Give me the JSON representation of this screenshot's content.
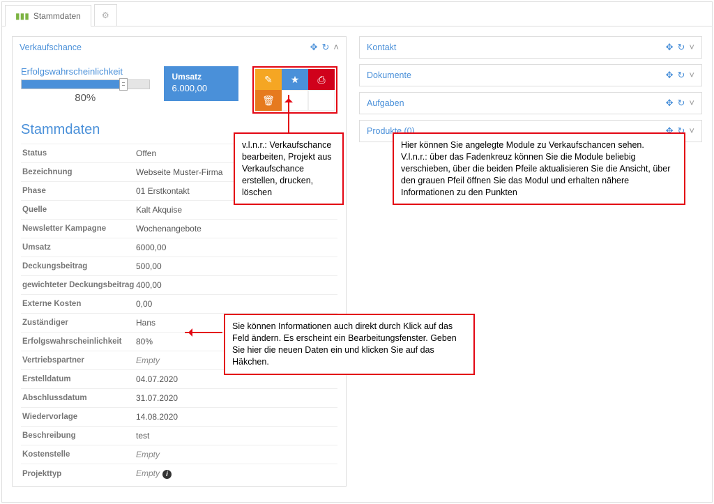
{
  "tabs": {
    "main": "Stammdaten"
  },
  "panel": {
    "verkaufschance_title": "Verkaufschance"
  },
  "metrics": {
    "probability_label": "Erfolgswahrscheinlichkeit",
    "probability_value": "80%",
    "umsatz_label": "Umsatz",
    "umsatz_value": "6.000,00"
  },
  "icons": {
    "edit": "✎",
    "star": "★",
    "print": "⎙",
    "trash": "🗑"
  },
  "section_title": "Stammdaten",
  "fields": {
    "status_label": "Status",
    "status_value": "Offen",
    "bezeichnung_label": "Bezeichnung",
    "bezeichnung_value": "Webseite Muster-Firma",
    "phase_label": "Phase",
    "phase_value": "01 Erstkontakt",
    "quelle_label": "Quelle",
    "quelle_value": "Kalt Akquise",
    "newsletter_label": "Newsletter Kampagne",
    "newsletter_value": "Wochenangebote",
    "umsatz_label": "Umsatz",
    "umsatz_value": "6000,00",
    "deckung_label": "Deckungsbeitrag",
    "deckung_value": "500,00",
    "gewicht_label": "gewichteter Deckungsbeitrag",
    "gewicht_value": "400,00",
    "externe_label": "Externe Kosten",
    "externe_value": "0,00",
    "zustaendiger_label": "Zuständiger",
    "zustaendiger_value": "Hans",
    "erfolg_label": "Erfolgswahrscheinlichkeit",
    "erfolg_value": "80%",
    "vertrieb_label": "Vertriebspartner",
    "vertrieb_value": "Empty",
    "erstell_label": "Erstelldatum",
    "erstell_value": "04.07.2020",
    "abschluss_label": "Abschlussdatum",
    "abschluss_value": "31.07.2020",
    "wieder_label": "Wiedervorlage",
    "wieder_value": "14.08.2020",
    "beschreibung_label": "Beschreibung",
    "beschreibung_value": "test",
    "kostenstelle_label": "Kostenstelle",
    "kostenstelle_value": "Empty",
    "projekttyp_label": "Projekttyp",
    "projekttyp_value": "Empty"
  },
  "right_panels": {
    "kontakt": "Kontakt",
    "dokumente": "Dokumente",
    "aufgaben": "Aufgaben",
    "produkte": "Produkte (0)"
  },
  "callouts": {
    "actions": "v.l.n.r.: Verkaufschance bearbeiten, Projekt aus Verkaufschance erstellen, drucken, löschen",
    "modules": "Hier können Sie angelegte Module zu Verkaufschancen sehen.\nV.l.n.r.: über das Fadenkreuz können Sie die Module beliebig verschieben, über die beiden Pfeile aktualisieren Sie die Ansicht, über den grauen Pfeil öffnen Sie das Modul und erhalten nähere Informationen zu den Punkten",
    "inline_edit": "Sie können Informationen auch direkt durch Klick auf das Feld ändern. Es erscheint ein Bearbeitungsfenster. Geben Sie hier die neuen Daten ein und klicken Sie auf das Häkchen."
  },
  "controls": {
    "move": "✥",
    "refresh": "↻",
    "collapse_up": "˄",
    "collapse_down": "˅"
  }
}
